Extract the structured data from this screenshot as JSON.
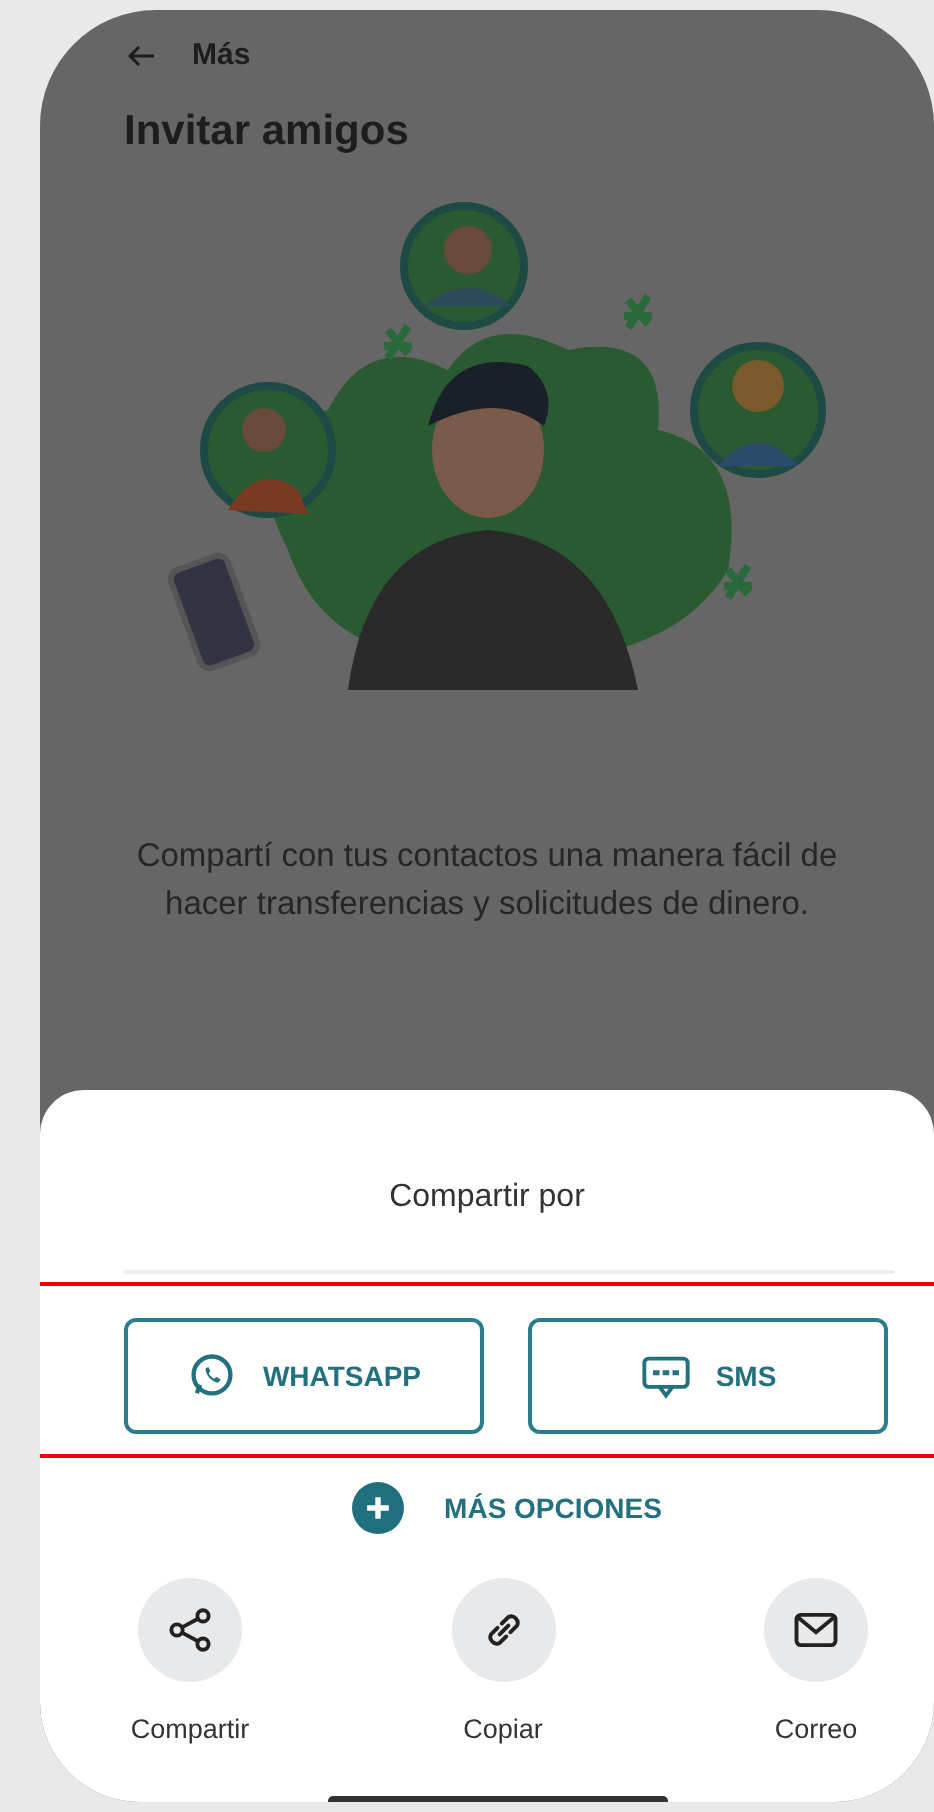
{
  "header": {
    "back_label": "Más",
    "title": "Invitar amigos"
  },
  "description": "Compartí con tus contactos una manera fácil de hacer transferencias y solicitudes de dinero.",
  "sheet": {
    "title": "Compartir por",
    "primary_highlighted": true,
    "primary_options": [
      {
        "kind": "whatsapp",
        "label": "WHATSAPP"
      },
      {
        "kind": "sms",
        "label": "SMS"
      }
    ],
    "more_options": "MÁS OPCIONES",
    "actions": [
      {
        "kind": "share",
        "label": "Compartir"
      },
      {
        "kind": "link",
        "label": "Copiar"
      },
      {
        "kind": "mail",
        "label": "Correo"
      }
    ]
  }
}
